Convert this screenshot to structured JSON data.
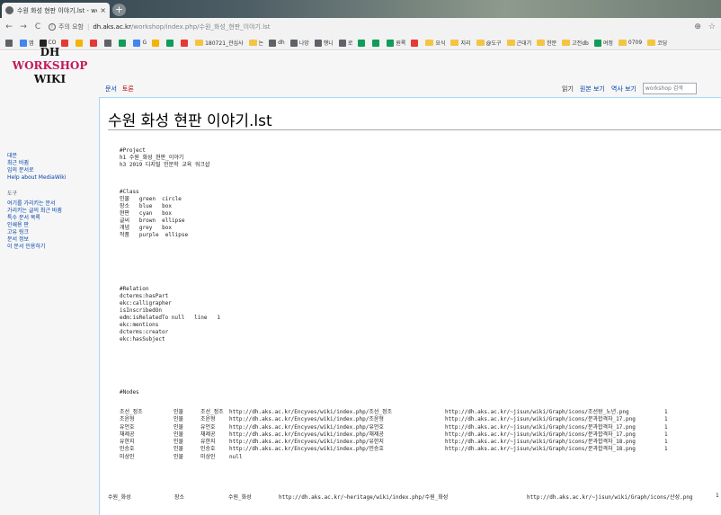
{
  "browser": {
    "tab_title": "수원 화성 현판 이야기.lst - work",
    "tab_close": "×",
    "new_tab": "+",
    "back": "←",
    "forward": "→",
    "reload": "C",
    "secure_label": "주의 요함",
    "url_host": "dh.aks.ac.kr",
    "url_path": "/workshop/index.php/수원_화성_현판_이야기.lst",
    "zoom_icon": "⊕",
    "star_icon": "☆",
    "bookmarks": [
      {
        "label": "",
        "color": "#5f6368",
        "folder": false
      },
      {
        "label": "앱",
        "color": "#4285f4",
        "folder": false
      },
      {
        "label": "CO",
        "color": "#222222",
        "folder": false
      },
      {
        "label": "",
        "color": "#e53935",
        "folder": false
      },
      {
        "label": "",
        "color": "#f4b400",
        "folder": false
      },
      {
        "label": "",
        "color": "#e53935",
        "folder": false
      },
      {
        "label": "",
        "color": "#5f6368",
        "folder": false
      },
      {
        "label": "",
        "color": "#0f9d58",
        "folder": false
      },
      {
        "label": "G",
        "color": "#4285f4",
        "folder": false
      },
      {
        "label": "",
        "color": "#f4b400",
        "folder": false
      },
      {
        "label": "",
        "color": "#0f9d58",
        "folder": false
      },
      {
        "label": "",
        "color": "#e53935",
        "folder": false
      },
      {
        "label": "180721_관심사",
        "color": "",
        "folder": true
      },
      {
        "label": "논",
        "color": "",
        "folder": true
      },
      {
        "label": "dh",
        "color": "#5f6368",
        "folder": false
      },
      {
        "label": "나망",
        "color": "#5f6368",
        "folder": false
      },
      {
        "label": "행니",
        "color": "#5f6368",
        "folder": false
      },
      {
        "label": "로",
        "color": "#5f6368",
        "folder": false
      },
      {
        "label": "",
        "color": "#0f9d58",
        "folder": false
      },
      {
        "label": "",
        "color": "#0f9d58",
        "folder": false
      },
      {
        "label": "원록",
        "color": "#0f9d58",
        "folder": false
      },
      {
        "label": "",
        "color": "#e53935",
        "folder": false
      },
      {
        "label": "요식",
        "color": "",
        "folder": true
      },
      {
        "label": "지리",
        "color": "",
        "folder": true
      },
      {
        "label": "@도구",
        "color": "",
        "folder": true
      },
      {
        "label": "근대기",
        "color": "",
        "folder": true
      },
      {
        "label": "한문",
        "color": "",
        "folder": true
      },
      {
        "label": "고전db",
        "color": "",
        "folder": true
      },
      {
        "label": "여정",
        "color": "#0f9d58",
        "folder": false
      },
      {
        "label": "0709",
        "color": "",
        "folder": true
      },
      {
        "label": "코딩",
        "color": "",
        "folder": true
      }
    ]
  },
  "logo": {
    "line1": "DH",
    "line2": "WORKSHOP",
    "line3": "WIKI"
  },
  "page_tabs": {
    "document": "문서",
    "discussion": "토론"
  },
  "view_tabs": {
    "read": "읽기",
    "view_source": "원본 보기",
    "history": "역사 보기",
    "search_placeholder": "workshop 검색"
  },
  "page_title": "수원 화성 현판 이야기.lst",
  "sidebar": {
    "nav": [
      "대문",
      "최근 바뀜",
      "임의 문서로",
      "Help about MediaWiki"
    ],
    "tools_heading": "도구",
    "tools": [
      "여기를 가리키는 문서",
      "가리키는 글의 최근 바뀜",
      "특수 문서 목록",
      "인쇄용 판",
      "고유 링크",
      "문서 정보",
      "이 문서 인용하기"
    ]
  },
  "code": {
    "project": "#Project\nh1 수원_화성_현판_이야기\nh3 2019 디지털 인문학 교육 워크샵",
    "class": "#Class\n인물   green  circle\n장소   blue   box\n현판   cyan   box\n글씨   brown  ellipse\n개념   grey   box\n작품   purple  ellipse",
    "relation": "#Relation\ndcterms:hasPart\nekc:calligrapher\nisInscribedOn\nedm:isRelatedTo null   line   1\nekc:mentions\ndcterms:creator\nekc:hasSubject",
    "nodes_heading": "#Nodes",
    "nodes": [
      {
        "id": "조선_정조",
        "cls": "인물",
        "label": "조선_정조",
        "url": "http://dh.aks.ac.kr/Encyves/wiki/index.php/조선_정조",
        "icon": "http://dh.aks.ac.kr/~jisun/wiki/Graph/icons/조선왕_노년.png",
        "n": "1"
      },
      {
        "id": "조윤형",
        "cls": "인물",
        "label": "조윤형",
        "url": "http://dh.aks.ac.kr/Encyves/wiki/index.php/조윤형",
        "icon": "http://dh.aks.ac.kr/~jisun/wiki/Graph/icons/문과합격자_17.png",
        "n": "1"
      },
      {
        "id": "유언호",
        "cls": "인물",
        "label": "유언호",
        "url": "http://dh.aks.ac.kr/Encyves/wiki/index.php/유언호",
        "icon": "http://dh.aks.ac.kr/~jisun/wiki/Graph/icons/문과합격자_17.png",
        "n": "1"
      },
      {
        "id": "채제공",
        "cls": "인물",
        "label": "채제공",
        "url": "http://dh.aks.ac.kr/Encyves/wiki/index.php/채제공",
        "icon": "http://dh.aks.ac.kr/~jisun/wiki/Graph/icons/문과합격자_17.png",
        "n": "1"
      },
      {
        "id": "유한지",
        "cls": "인물",
        "label": "유한지",
        "url": "http://dh.aks.ac.kr/Encyves/wiki/index.php/유한지",
        "icon": "http://dh.aks.ac.kr/~jisun/wiki/Graph/icons/문과합격자_18.png",
        "n": "1"
      },
      {
        "id": "민승호",
        "cls": "인물",
        "label": "민승호",
        "url": "http://dh.aks.ac.kr/Encyves/wiki/index.php/민승호",
        "icon": "http://dh.aks.ac.kr/~jisun/wiki/Graph/icons/문과합격자_18.png",
        "n": "1"
      },
      {
        "id": "미상인",
        "cls": "인물",
        "label": "미상인",
        "url": "null",
        "icon": "",
        "n": ""
      }
    ],
    "bottom_row": {
      "id": "수원_화성",
      "cls": "장소",
      "label": "수원_화성",
      "url": "http://dh.aks.ac.kr/~heritage/wiki/index.php/수원_화성",
      "icon": "http://dh.aks.ac.kr/~jisun/wiki/Graph/icons/산성.png",
      "n": "1"
    }
  }
}
